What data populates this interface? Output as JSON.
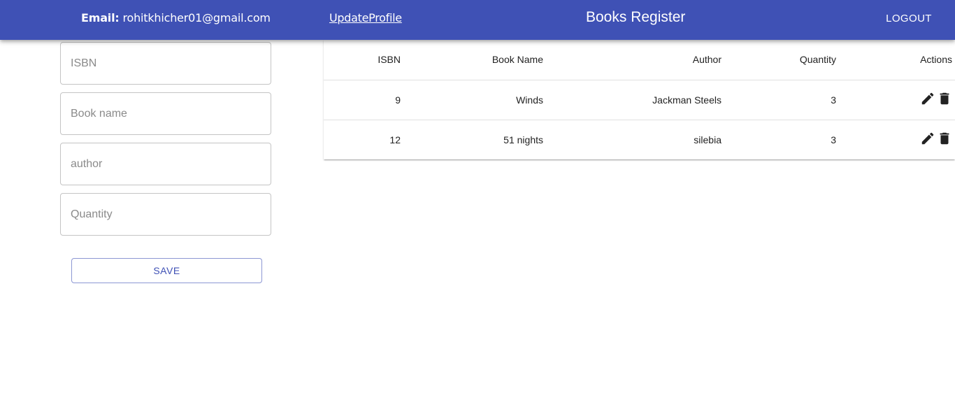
{
  "header": {
    "email_key": "Email:",
    "email_value": "rohitkhicher01@gmail.com",
    "update_profile": "UpdateProfile",
    "title": "Books Register",
    "logout": "LOGOUT"
  },
  "form": {
    "isbn_placeholder": "ISBN",
    "book_name_placeholder": "Book name",
    "author_placeholder": "author",
    "quantity_placeholder": "Quantity",
    "save_label": "SAVE"
  },
  "table": {
    "columns": [
      "ISBN",
      "Book Name",
      "Author",
      "Quantity",
      "Actions"
    ],
    "rows": [
      {
        "isbn": "9",
        "name": "Winds",
        "author": "Jackman Steels",
        "quantity": "3"
      },
      {
        "isbn": "12",
        "name": "51 nights",
        "author": "silebia",
        "quantity": "3"
      }
    ]
  },
  "icons": {
    "edit": "pencil-icon",
    "delete": "trash-icon"
  },
  "colors": {
    "appbar": "#3f51b5",
    "accent": "#3f51b5"
  }
}
